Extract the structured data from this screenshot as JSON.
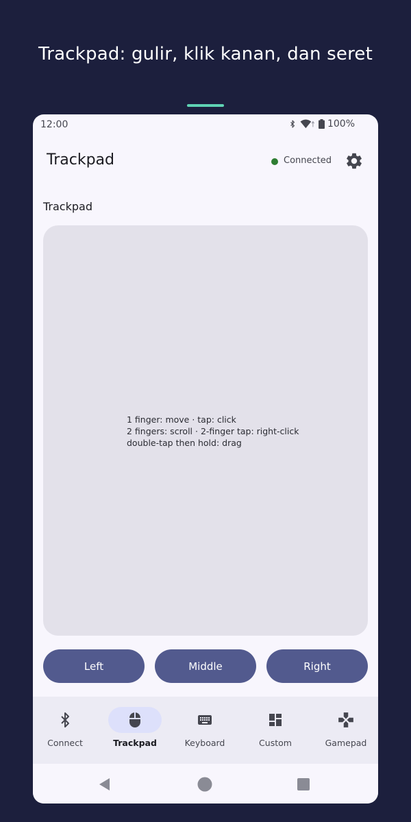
{
  "promo": {
    "title": "Trackpad: gulir, klik kanan, dan seret",
    "accent_color": "#5fd3b4"
  },
  "status_bar": {
    "time": "12:00",
    "battery": "100%",
    "icons": [
      "bluetooth-icon",
      "wifi-icon",
      "battery-icon"
    ]
  },
  "app_bar": {
    "title": "Trackpad",
    "connection_status": "Connected",
    "connection_color": "#2e7d32",
    "settings_icon": "gear-icon"
  },
  "trackpad": {
    "section_title": "Trackpad",
    "hints": [
      "1 finger: move · tap: click",
      "2 fingers: scroll · 2-finger tap: right-click",
      "double-tap then hold: drag"
    ]
  },
  "mouse_buttons": {
    "left": "Left",
    "middle": "Middle",
    "right": "Right",
    "color": "#525a8e"
  },
  "bottom_nav": {
    "items": [
      {
        "label": "Connect",
        "icon": "bluetooth-icon"
      },
      {
        "label": "Trackpad",
        "icon": "mouse-icon",
        "active": true
      },
      {
        "label": "Keyboard",
        "icon": "keyboard-icon"
      },
      {
        "label": "Custom",
        "icon": "dashboard-icon"
      },
      {
        "label": "Gamepad",
        "icon": "gamepad-icon"
      }
    ]
  },
  "system_nav": {
    "icons": [
      "back-icon",
      "home-icon",
      "recents-icon"
    ]
  }
}
